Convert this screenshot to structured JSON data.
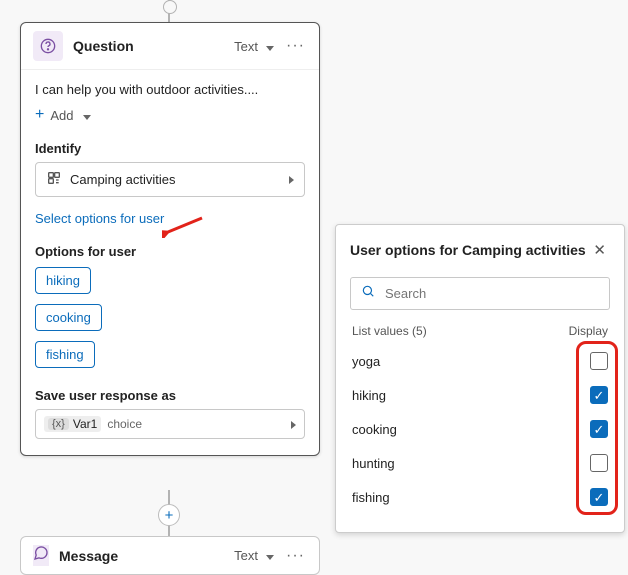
{
  "question_card": {
    "title": "Question",
    "type_label": "Text",
    "body_text": "I can help you with outdoor activities....",
    "add_label": "Add",
    "identify_label": "Identify",
    "identify_value": "Camping activities",
    "select_options_link": "Select options for user",
    "options_label": "Options for user",
    "options": [
      "hiking",
      "cooking",
      "fishing"
    ],
    "save_label": "Save user response as",
    "var_name": "Var1",
    "var_type": "choice"
  },
  "message_card": {
    "title": "Message",
    "type_label": "Text"
  },
  "panel": {
    "title": "User options for Camping activities",
    "search_placeholder": "Search",
    "list_label": "List values (5)",
    "display_label": "Display",
    "items": [
      {
        "label": "yoga",
        "checked": false
      },
      {
        "label": "hiking",
        "checked": true
      },
      {
        "label": "cooking",
        "checked": true
      },
      {
        "label": "hunting",
        "checked": false
      },
      {
        "label": "fishing",
        "checked": true
      }
    ]
  }
}
